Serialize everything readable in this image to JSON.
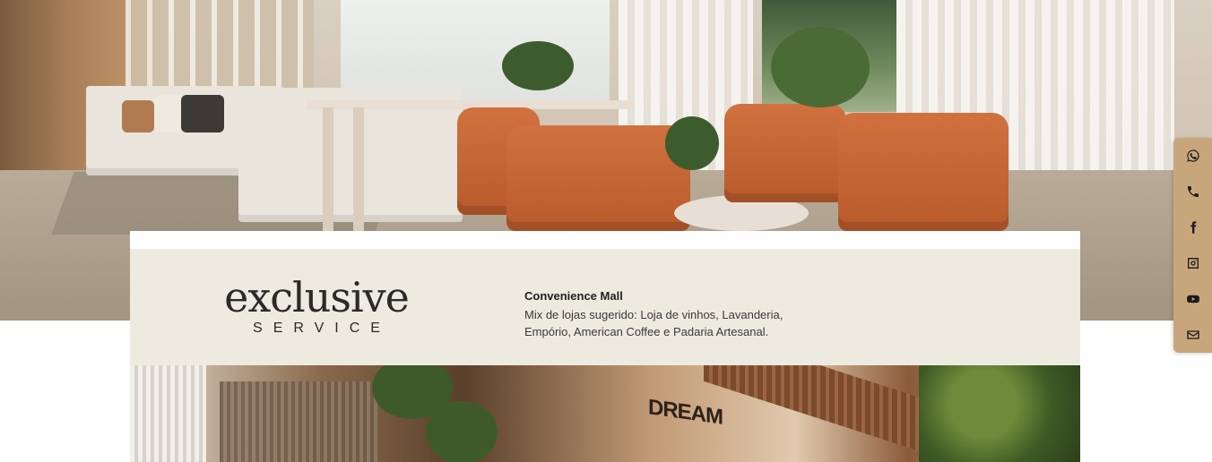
{
  "info_card": {
    "logo_main": "exclusive",
    "logo_sub": "SERVICE",
    "title": "Convenience Mall",
    "description": "Mix de lojas sugerido: Loja de vinhos, Lavanderia, Empório, American Coffee e Padaria Artesanal."
  },
  "storefront": {
    "sign": "DREAM"
  },
  "social_bar": {
    "background": "#c8a67c",
    "icon_color": "#1b1b1b",
    "items": [
      "whatsapp-icon",
      "phone-icon",
      "facebook-icon",
      "instagram-icon",
      "youtube-icon",
      "email-icon"
    ]
  },
  "colors": {
    "card_background": "#edeadf",
    "chair_accent": "#c8653a"
  }
}
